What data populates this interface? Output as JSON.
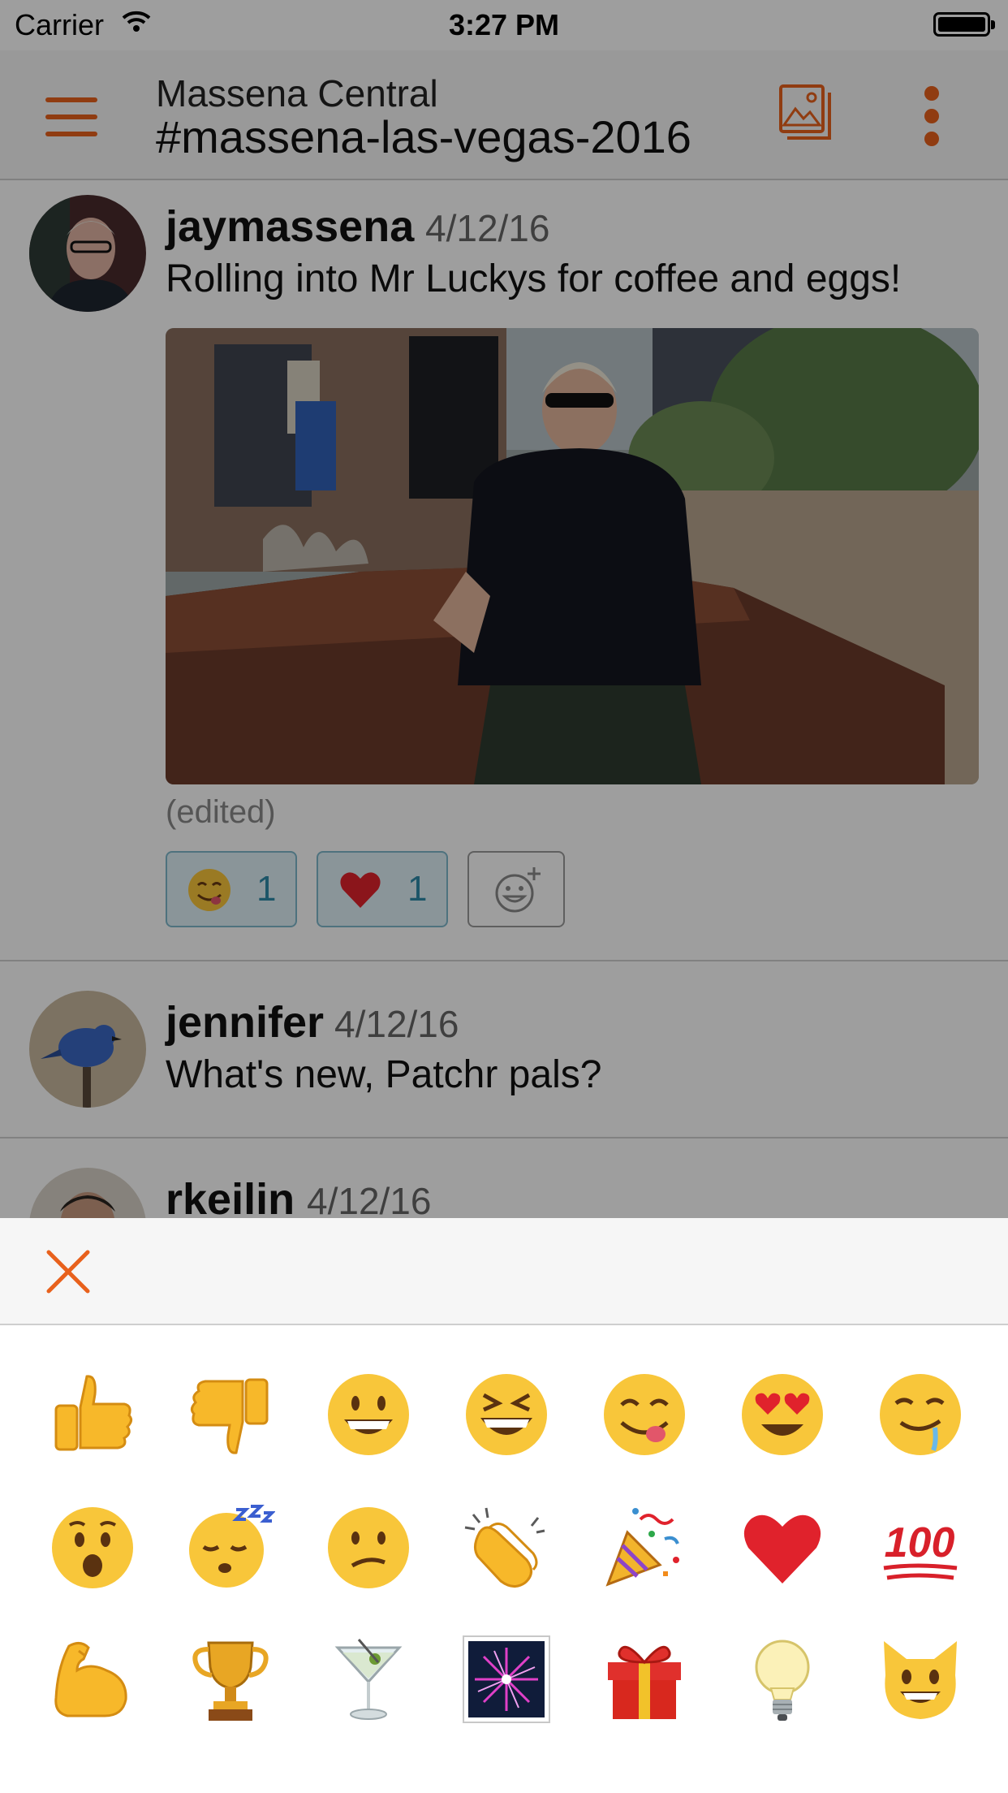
{
  "status_bar": {
    "carrier": "Carrier",
    "time": "3:27 PM"
  },
  "header": {
    "subtitle": "Massena Central",
    "title": "#massena-las-vegas-2016"
  },
  "messages": [
    {
      "author": "jaymassena",
      "date": "4/12/16",
      "text": "Rolling into Mr Luckys for coffee and eggs!",
      "edited_label": "(edited)",
      "reactions": [
        {
          "emoji": "yum-face",
          "count": "1"
        },
        {
          "emoji": "red-heart",
          "count": "1"
        }
      ]
    },
    {
      "author": "jennifer",
      "date": "4/12/16",
      "text": "What's new, Patchr pals?"
    },
    {
      "author": "rkeilin",
      "date": "4/12/16"
    }
  ],
  "emoji_picker": {
    "rows": [
      [
        "thumbs-up",
        "thumbs-down",
        "grinning-face",
        "laughing-face",
        "yum-face",
        "heart-eyes-face",
        "drooling-face"
      ],
      [
        "astonished-face",
        "sleeping-face",
        "confused-face",
        "clapping-hands",
        "party-popper",
        "red-heart",
        "hundred-points"
      ],
      [
        "flexed-biceps",
        "trophy",
        "cocktail-glass",
        "fireworks",
        "wrapped-gift",
        "light-bulb",
        "smiley-cat"
      ]
    ],
    "hundred_text": "100"
  },
  "colors": {
    "accent": "#e8611c",
    "reaction_bg": "#dff0f7",
    "reaction_border": "#7fb9cc",
    "reaction_count": "#2e8aa8"
  }
}
